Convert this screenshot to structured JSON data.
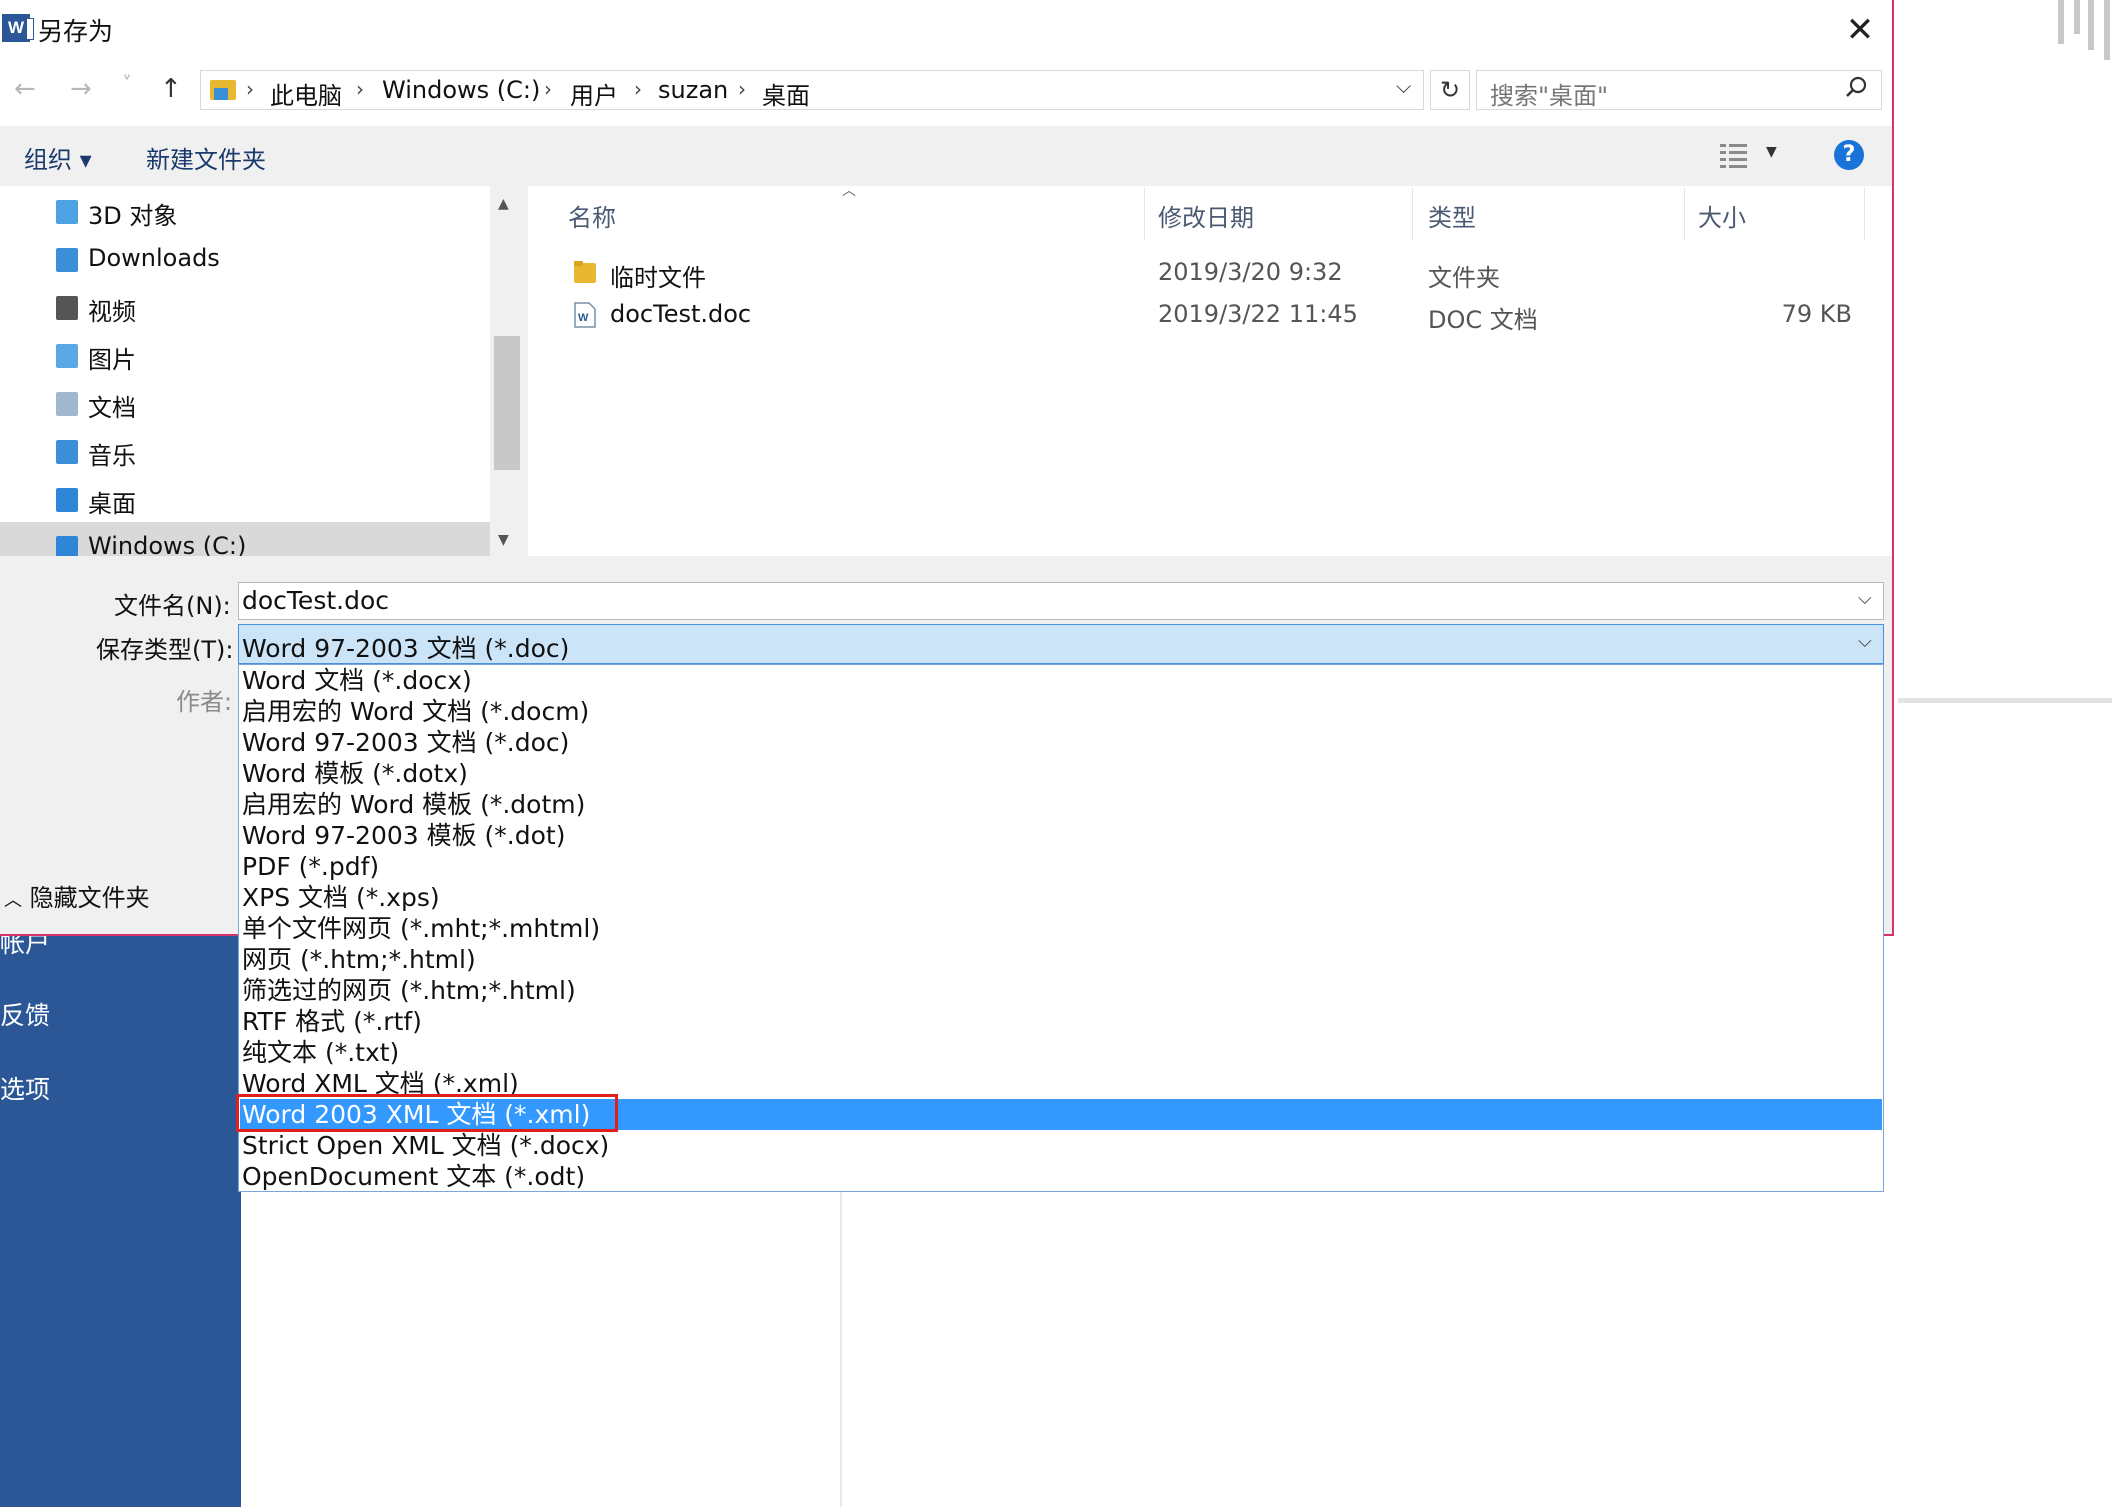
{
  "background": {
    "nav_items": [
      "帐户",
      "反馈",
      "选项"
    ]
  },
  "dialog": {
    "title": "另存为",
    "close_glyph": "✕",
    "nav": {
      "back": "←",
      "forward": "→",
      "recent": "˅",
      "up": "↑"
    },
    "breadcrumb": [
      "此电脑",
      "Windows (C:)",
      "用户",
      "suzan",
      "桌面"
    ],
    "search_placeholder": "搜索\"桌面\"",
    "toolbar": {
      "organize": "组织 ▾",
      "new_folder": "新建文件夹",
      "help": "?"
    },
    "nav_pane": [
      {
        "label": "3D 对象",
        "icon": "3d-objects-icon",
        "color": "#4ba3e3"
      },
      {
        "label": "Downloads",
        "icon": "downloads-icon",
        "color": "#3a8fd8"
      },
      {
        "label": "视频",
        "icon": "videos-icon",
        "color": "#555"
      },
      {
        "label": "图片",
        "icon": "pictures-icon",
        "color": "#5aa9e6"
      },
      {
        "label": "文档",
        "icon": "documents-icon",
        "color": "#9fb8cf"
      },
      {
        "label": "音乐",
        "icon": "music-icon",
        "color": "#3a8fd8"
      },
      {
        "label": "桌面",
        "icon": "desktop-icon",
        "color": "#2f86d6"
      },
      {
        "label": "Windows (C:)",
        "icon": "drive-icon",
        "color": "#2f86d6"
      }
    ],
    "columns": [
      "名称",
      "修改日期",
      "类型",
      "大小"
    ],
    "files": [
      {
        "name": "临时文件",
        "date": "2019/3/20 9:32",
        "type": "文件夹",
        "size": ""
      },
      {
        "name": "docTest.doc",
        "date": "2019/3/22 11:45",
        "type": "DOC 文档",
        "size": "79 KB"
      }
    ],
    "form": {
      "filename_label": "文件名(N):",
      "filename_value": "docTest.doc",
      "filetype_label": "保存类型(T):",
      "filetype_value": "Word 97-2003 文档 (*.doc)",
      "author_label": "作者:",
      "hide_folders": "隐藏文件夹"
    },
    "filetype_options": [
      "Word 文档 (*.docx)",
      "启用宏的 Word 文档 (*.docm)",
      "Word 97-2003 文档 (*.doc)",
      "Word 模板 (*.dotx)",
      "启用宏的 Word 模板 (*.dotm)",
      "Word 97-2003 模板 (*.dot)",
      "PDF (*.pdf)",
      "XPS 文档 (*.xps)",
      "单个文件网页 (*.mht;*.mhtml)",
      "网页 (*.htm;*.html)",
      "筛选过的网页 (*.htm;*.html)",
      "RTF 格式 (*.rtf)",
      "纯文本 (*.txt)",
      "Word XML 文档 (*.xml)",
      "Word 2003 XML 文档 (*.xml)",
      "Strict Open XML 文档 (*.docx)",
      "OpenDocument 文本 (*.odt)"
    ],
    "selected_option_index": 14
  },
  "colors": {
    "accent": "#3399ff",
    "dialog_border": "#d6336c",
    "word_blue": "#2b5797",
    "highlight_box": "#e02020"
  }
}
